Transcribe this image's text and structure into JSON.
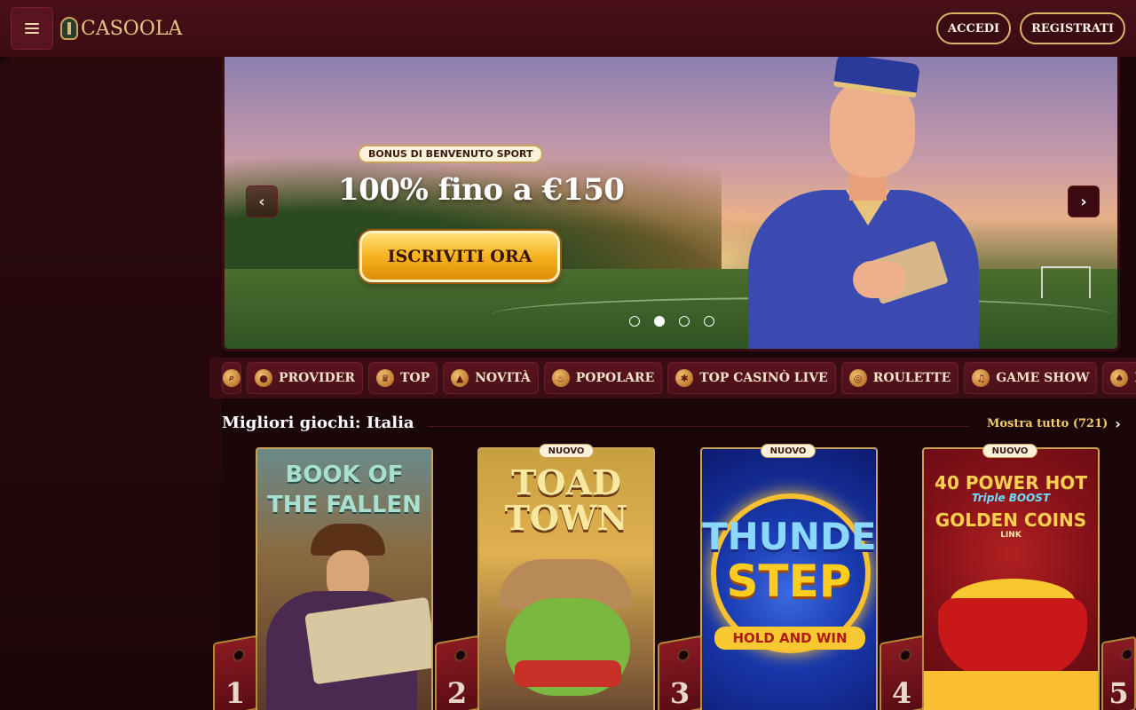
{
  "header": {
    "logo_text": "CASOOLA",
    "login_label": "ACCEDI",
    "register_label": "REGISTRATI"
  },
  "hero": {
    "badge": "BONUS DI BENVENUTO SPORT",
    "title": "100% fino a €150",
    "cta": "ISCRIVITI ORA",
    "prev_glyph": "‹",
    "next_glyph": "›",
    "slides_total": 4,
    "active_slide": 2
  },
  "categories": [
    {
      "label": "",
      "icon": "search-icon"
    },
    {
      "label": "PROVIDER",
      "icon": "provider-icon"
    },
    {
      "label": "TOP",
      "icon": "crown-icon"
    },
    {
      "label": "NOVITÀ",
      "icon": "bell-icon"
    },
    {
      "label": "POPOLARE",
      "icon": "flame-icon"
    },
    {
      "label": "TOP CASINÒ LIVE",
      "icon": "chip-icon"
    },
    {
      "label": "ROULETTE",
      "icon": "roulette-icon"
    },
    {
      "label": "GAME SHOW",
      "icon": "microphone-icon"
    },
    {
      "label": "BL",
      "icon": "cards-icon"
    }
  ],
  "section": {
    "title": "Migliori giochi: Italia",
    "show_all": "Mostra tutto (721)"
  },
  "games": [
    {
      "title_line1": "BOOK OF",
      "title_line2": "THE FALLEN",
      "rank": "1",
      "new_badge": ""
    },
    {
      "title_line1": "TOAD",
      "title_line2": "TOWN",
      "rank": "2",
      "new_badge": "NUOVO"
    },
    {
      "title_line1": "THUNDER",
      "title_line2": "STEP",
      "subtitle": "HOLD AND WIN",
      "rank": "3",
      "new_badge": "NUOVO"
    },
    {
      "title_line1": "40 POWER HOT",
      "title_line2": "GOLDEN COINS",
      "subtitle": "Triple BOOST",
      "tag": "LINK",
      "rank": "4",
      "new_badge": "NUOVO"
    }
  ],
  "rank_5": "5",
  "colors": {
    "background": "#1a0608",
    "header": "#4a1018",
    "accent_gold": "#c9a35a",
    "cta_yellow": "#f5b21e",
    "show_all": "#f4cc6a"
  }
}
